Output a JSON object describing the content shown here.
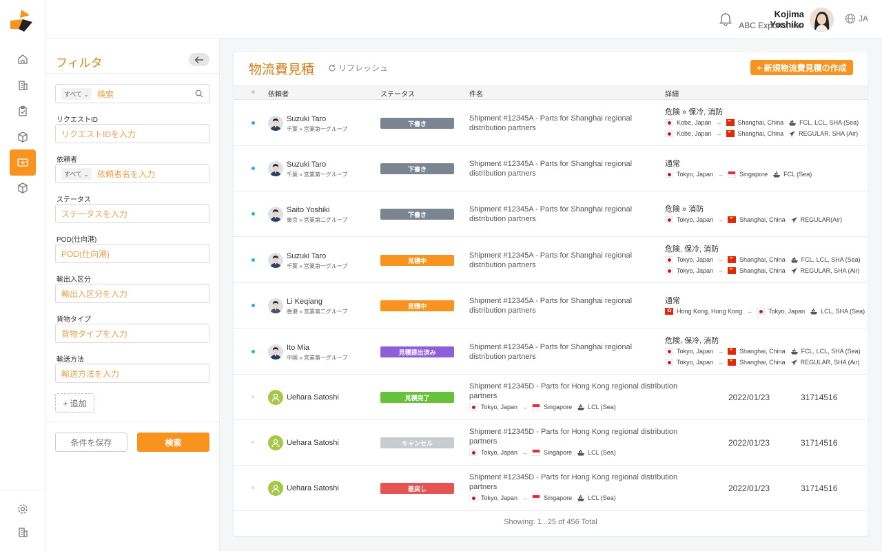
{
  "user": {
    "name": "Kojima Yoshiko",
    "company": "ABC Exports, Inc.",
    "lang": "JA"
  },
  "filter": {
    "title": "フィルタ",
    "search": {
      "prefix": "すべて",
      "placeholder": "検索"
    },
    "fields": [
      {
        "label": "リクエストID",
        "placeholder": "リクエストIDを入力"
      },
      {
        "label": "依頼者",
        "prefix": "すべて",
        "placeholder": "依頼者名を入力"
      },
      {
        "label": "ステータス",
        "placeholder": "ステータスを入力"
      },
      {
        "label": "POD(仕向港)",
        "placeholder": "POD(仕向港)"
      },
      {
        "label": "輸出入区分",
        "placeholder": "輸出入区分を入力"
      },
      {
        "label": "貨物タイプ",
        "placeholder": "貨物タイプを入力"
      },
      {
        "label": "輸送方法",
        "placeholder": "輸送方法を入力"
      }
    ],
    "add_label": "+ 追加",
    "save_label": "条件を保存",
    "search_label": "検索"
  },
  "main": {
    "title": "物流費見積",
    "refresh_label": "リフレッシュ",
    "new_label": "+ 新規物流費見積の作成",
    "columns": [
      "依頼者",
      "ステータス",
      "件名",
      "詳細"
    ],
    "rows": [
      {
        "name": "Suzuki Taro",
        "dept": "千葉 » 営業第一グループ",
        "status": "下書き",
        "status_color": "#7b8591",
        "subject": "Shipment #12345A - Parts for Shanghai regional distribution partners",
        "detail": "危険 » 保冷, 消防",
        "routes": [
          {
            "from": "Kobe, Japan",
            "to": "Shanghai, China",
            "mode": "FCL, LCL, SHA (Sea)"
          },
          {
            "from": "Kobe, Japan",
            "to": "Shanghai, China",
            "mode": "REGULAR, SHA (Air)"
          }
        ]
      },
      {
        "name": "Suzuki Taro",
        "dept": "千葉 » 営業第一グループ",
        "status": "下書き",
        "status_color": "#7b8591",
        "subject": "Shipment #12345A - Parts for Shanghai regional distribution partners",
        "detail": "通常",
        "routes": [
          {
            "from": "Tokyo, Japan",
            "to": "Singapore",
            "mode": "FCL (Sea)"
          }
        ]
      },
      {
        "name": "Saito Yoshiki",
        "dept": "東京 » 営業第二グループ",
        "status": "下書き",
        "status_color": "#7b8591",
        "subject": "Shipment #12345A - Parts for Shanghai regional distribution partners",
        "detail": "危険 » 消防",
        "routes": [
          {
            "from": "Tokyo, Japan",
            "to": "Shanghai, China",
            "mode": "REGULAR(Air)"
          }
        ]
      },
      {
        "name": "Suzuki Taro",
        "dept": "千葉 » 営業第一グループ",
        "status": "見積中",
        "status_color": "#f7931e",
        "subject": "Shipment #12345A - Parts for Shanghai regional distribution partners",
        "detail": "危険, 保冷, 消防",
        "routes": [
          {
            "from": "Tokyo, Japan",
            "to": "Shanghai, China",
            "mode": "FCL, LCL, SHA (Sea)"
          },
          {
            "from": "Tokyo, Japan",
            "to": "Shanghai, China",
            "mode": "REGULAR, SHA (Air)"
          }
        ]
      },
      {
        "name": "Li Keqiang",
        "dept": "香港 » 営業第二グループ",
        "status": "見積中",
        "status_color": "#f7931e",
        "subject": "Shipment #12345A - Parts for Shanghai regional distribution partners",
        "detail": "通常",
        "routes": [
          {
            "from": "Hong Kong, Hong Kong",
            "to": "Tokyo, Japan",
            "mode": "LCL, SHA (Sea)"
          }
        ]
      },
      {
        "name": "Ito Mia",
        "dept": "中国 » 営業第一グループ",
        "status": "見積提出済み",
        "status_color": "#8e5fd8",
        "subject": "Shipment #12345A - Parts for Shanghai regional distribution partners",
        "detail": "危険, 保冷, 消防",
        "routes": [
          {
            "from": "Tokyo, Japan",
            "to": "Shanghai, China",
            "mode": "FCL, LCL, SHA (Sea)"
          },
          {
            "from": "Tokyo, Japan",
            "to": "Shanghai, China",
            "mode": "REGULAR, SHA (Air)"
          }
        ]
      },
      {
        "name": "Uehara Satoshi",
        "status": "見積完了",
        "status_color": "#67c23a",
        "subject": "Shipment #12345D - Parts for Hong Kong regional distribution partners",
        "route": {
          "from": "Tokyo, Japan",
          "to": "Singapore",
          "mode": "LCL (Sea)"
        },
        "date": "2022/01/23",
        "number": "31714516"
      },
      {
        "name": "Uehara Satoshi",
        "status": "キャンセル",
        "status_color": "#c8ccd1",
        "subject": "Shipment #12345D - Parts for Hong Kong regional distribution partners",
        "route": {
          "from": "Tokyo, Japan",
          "to": "Singapore",
          "mode": "LCL (Sea)"
        },
        "date": "2022/01/23",
        "number": "31714516"
      },
      {
        "name": "Uehara Satoshi",
        "status": "差戻し",
        "status_color": "#e55353",
        "subject": "Shipment #12345D - Parts for Hong Kong regional distribution partners",
        "route": {
          "from": "Tokyo, Japan",
          "to": "Singapore",
          "mode": "LCL (Sea)"
        },
        "date": "2022/01/23",
        "number": "31714516"
      }
    ],
    "footer": "Showing: 1...25 of 456 Total"
  },
  "colors": {
    "accent": "#f7931e",
    "title": "#d07b12",
    "unread_dot": "#1fb4d8"
  }
}
